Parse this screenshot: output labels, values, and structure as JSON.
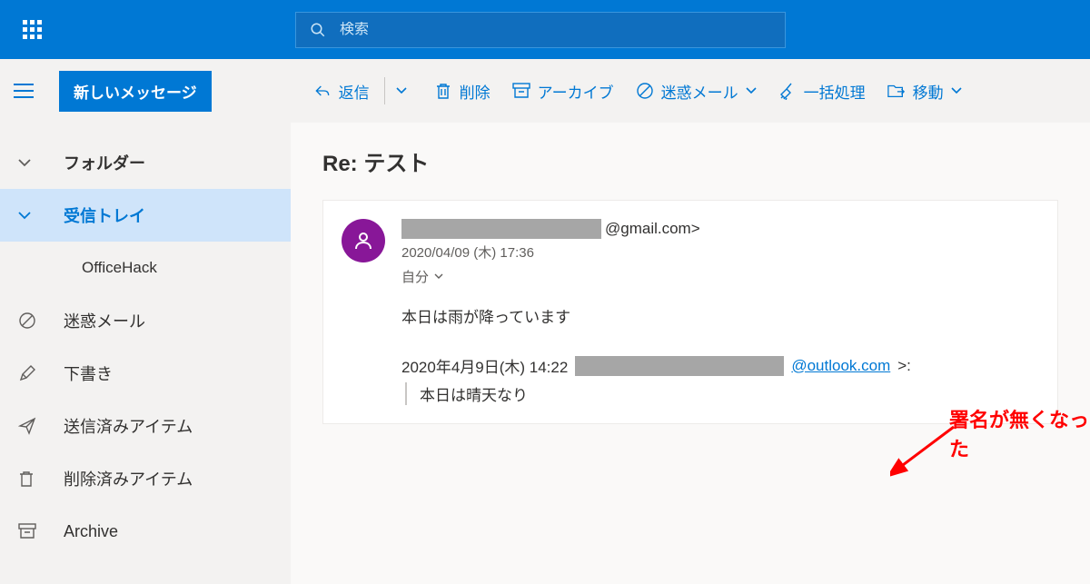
{
  "search": {
    "placeholder": "検索"
  },
  "toolbar": {
    "new_message": "新しいメッセージ",
    "reply": "返信",
    "delete": "削除",
    "archive": "アーカイブ",
    "junk": "迷惑メール",
    "sweep": "一括処理",
    "move": "移動"
  },
  "sidebar": {
    "folders_label": "フォルダー",
    "items": [
      {
        "label": "受信トレイ"
      },
      {
        "label": "OfficeHack"
      },
      {
        "label": "迷惑メール"
      },
      {
        "label": "下書き"
      },
      {
        "label": "送信済みアイテム"
      },
      {
        "label": "削除済みアイテム"
      },
      {
        "label": "Archive"
      }
    ]
  },
  "message": {
    "subject": "Re: テスト",
    "sender_suffix": "@gmail.com>",
    "date": "2020/04/09 (木) 17:36",
    "to": "自分",
    "body_line1": "本日は雨が降っています",
    "quoted_date": "2020年4月9日(木) 14:22",
    "quoted_email_suffix": "@outlook.com",
    "quoted_tail": ">:",
    "quoted_body": "本日は晴天なり"
  },
  "annotation": "署名が無くなった"
}
